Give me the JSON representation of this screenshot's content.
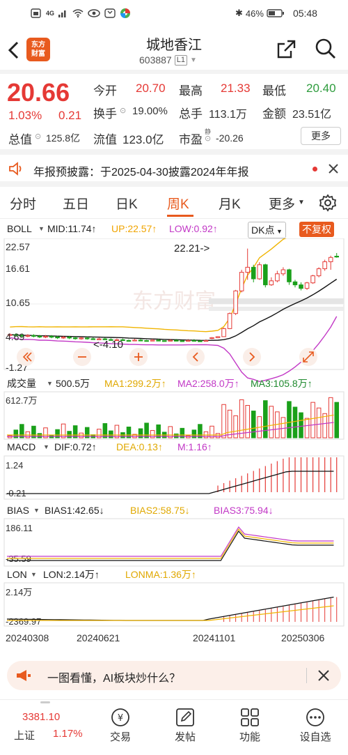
{
  "status": {
    "network": "4G",
    "battery_pct": "46%",
    "time": "05:48"
  },
  "header": {
    "logo_line1": "东方",
    "logo_line2": "财富",
    "title": "城地香江",
    "code": "603887",
    "level": "L1"
  },
  "quote": {
    "price": "20.66",
    "change_pct": "1.03%",
    "change": "0.21",
    "open_label": "今开",
    "open": "20.70",
    "high_label": "最高",
    "high": "21.33",
    "low_label": "最低",
    "low": "20.40",
    "turnover_label": "换手",
    "turnover": "19.00%",
    "volume_label": "总手",
    "volume": "113.1万",
    "amount_label": "金额",
    "amount": "23.51亿",
    "mcap_label": "总值",
    "mcap": "125.8亿",
    "float_label": "流值",
    "float_cap": "123.0亿",
    "pe_label": "市盈",
    "pe_sup": "静",
    "pe": "-20.26",
    "more_button": "更多"
  },
  "notice": {
    "text": "年报预披露：于2025-04-30披露2024年年报"
  },
  "period_tabs": [
    "分时",
    "五日",
    "日K",
    "周K",
    "月K",
    "更多"
  ],
  "active_tab": "周K",
  "boll_bar": {
    "name": "BOLL",
    "mid": "MID:11.74↑",
    "up": "UP:22.57↑",
    "low": "LOW:0.92↑",
    "dk": "DK点",
    "fuquan": "不复权"
  },
  "main_chart": {
    "y_ticks": [
      "22.57",
      "16.61",
      "10.65",
      "4.69",
      "-1.27"
    ],
    "high_annotation": "22.21->",
    "low_annotation": "<-4.10",
    "watermark": "东方财富"
  },
  "volume_bar": {
    "name": "成交量",
    "value": "500.5万",
    "ma1": "MA1:299.2万↑",
    "ma2": "MA2:258.0万↑",
    "ma3": "MA3:105.8万↑",
    "y_top": "612.7万"
  },
  "macd_bar": {
    "name": "MACD",
    "dif": "DIF:0.72↑",
    "dea": "DEA:0.13↑",
    "m": "M:1.16↑",
    "y_top": "1.24",
    "y_bottom": "-0.21"
  },
  "bias_bar": {
    "name": "BIAS",
    "b1": "BIAS1:42.65↓",
    "b2": "BIAS2:58.75↓",
    "b3": "BIAS3:75.94↓",
    "y_top": "186.11",
    "y_bottom": "-35.59"
  },
  "lon_bar": {
    "name": "LON",
    "lon": "LON:2.14万↑",
    "lonma": "LONMA:1.36万↑",
    "y_top": "2.14万",
    "y_bottom": "-2369.97"
  },
  "x_dates": [
    "20240308",
    "20240621",
    "20241101",
    "20250306"
  ],
  "ai_banner": {
    "text": "一图看懂，AI板块炒什么？"
  },
  "bottom_nav": {
    "index_value": "3381.10",
    "index_name": "上证",
    "index_change": "1.17%",
    "items": [
      "交易",
      "发帖",
      "功能",
      "设自选"
    ]
  },
  "colors": {
    "up_red": "#e53935",
    "down_green": "#1aa01a",
    "accent_orange": "#e85a1e",
    "ma_yellow": "#f0b400",
    "ma_purple": "#c238c6"
  },
  "chart_data": {
    "type": "candlestick",
    "title": "城地香江 周K",
    "candles_ohlc_tail": [
      [
        4.4,
        4.6,
        4.2,
        4.5
      ],
      [
        4.5,
        4.8,
        4.4,
        4.7
      ],
      [
        4.7,
        6.5,
        4.7,
        6.3
      ],
      [
        6.3,
        9.5,
        6.2,
        9.3
      ],
      [
        9.3,
        14.0,
        9.0,
        13.8
      ],
      [
        13.8,
        18.0,
        13.5,
        17.5
      ],
      [
        17.5,
        22.21,
        16.0,
        18.5
      ],
      [
        18.5,
        19.0,
        15.5,
        16.2
      ],
      [
        16.2,
        19.5,
        16.0,
        19.0
      ],
      [
        19.0,
        19.2,
        14.5,
        15.0
      ],
      [
        15.0,
        16.5,
        14.8,
        15.8
      ],
      [
        15.8,
        17.8,
        15.5,
        17.2
      ],
      [
        17.2,
        18.5,
        16.8,
        18.0
      ],
      [
        18.0,
        18.2,
        15.0,
        15.6
      ],
      [
        15.6,
        16.0,
        14.5,
        15.0
      ],
      [
        15.0,
        15.5,
        13.9,
        14.3
      ],
      [
        14.3,
        15.6,
        14.0,
        15.4
      ],
      [
        15.4,
        17.0,
        15.2,
        16.8
      ],
      [
        16.8,
        18.5,
        16.5,
        18.2
      ],
      [
        18.2,
        20.0,
        17.8,
        19.6
      ],
      [
        19.6,
        20.8,
        18.0,
        20.45
      ],
      [
        20.7,
        21.33,
        20.4,
        20.66
      ]
    ],
    "low_value": 4.1,
    "high_value": 22.21,
    "ylim": [
      -1.27,
      22.57
    ]
  }
}
